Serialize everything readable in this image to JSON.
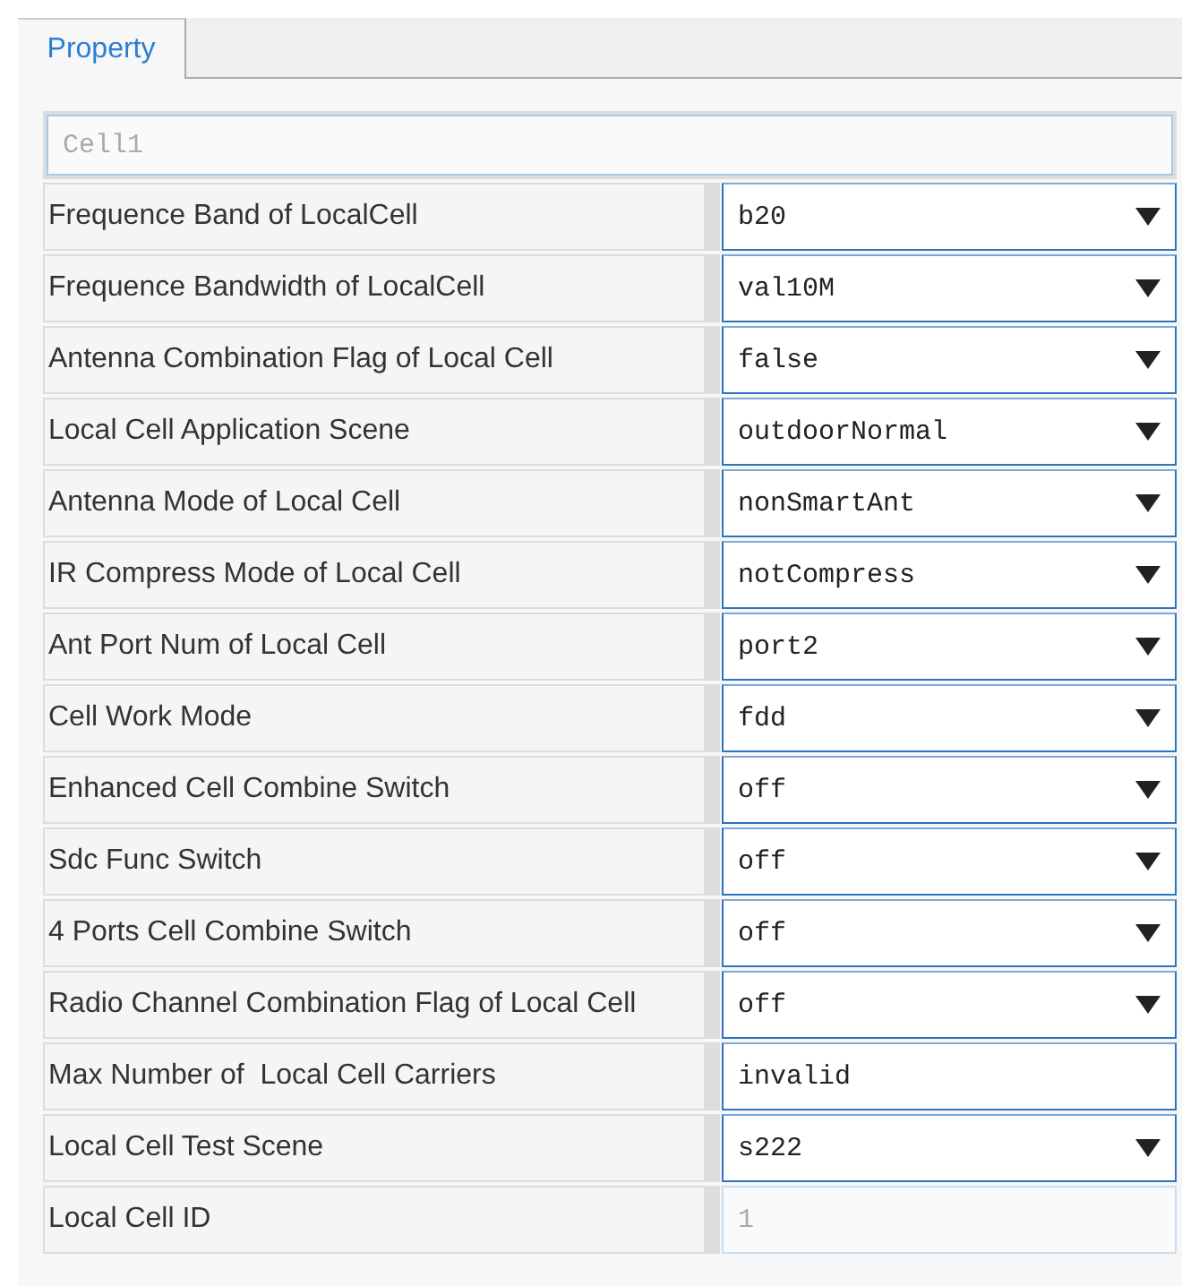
{
  "tabs": [
    {
      "label": "Property",
      "selected": true
    }
  ],
  "name_field": {
    "value": "Cell1",
    "disabled": true
  },
  "rows": [
    {
      "label": "Frequence Band of LocalCell",
      "kind": "select",
      "value": "b20"
    },
    {
      "label": "Frequence Bandwidth of LocalCell",
      "kind": "select",
      "value": "val10M"
    },
    {
      "label": "Antenna Combination Flag of Local Cell",
      "kind": "select",
      "value": "false"
    },
    {
      "label": "Local Cell Application Scene",
      "kind": "select",
      "value": "outdoorNormal"
    },
    {
      "label": "Antenna Mode of Local Cell",
      "kind": "select",
      "value": "nonSmartAnt"
    },
    {
      "label": "IR Compress Mode of Local Cell",
      "kind": "select",
      "value": "notCompress"
    },
    {
      "label": "Ant Port Num of Local Cell",
      "kind": "select",
      "value": "port2"
    },
    {
      "label": "Cell Work Mode",
      "kind": "select",
      "value": "fdd"
    },
    {
      "label": "Enhanced Cell Combine Switch",
      "kind": "select",
      "value": "off"
    },
    {
      "label": "Sdc Func Switch",
      "kind": "select",
      "value": "off"
    },
    {
      "label": "4 Ports Cell Combine Switch",
      "kind": "select",
      "value": "off"
    },
    {
      "label": "Radio Channel Combination Flag of Local Cell",
      "kind": "select",
      "value": "off"
    },
    {
      "label": "Max Number of  Local Cell Carriers",
      "kind": "text",
      "value": "invalid"
    },
    {
      "label": "Local Cell Test Scene",
      "kind": "select",
      "value": "s222"
    },
    {
      "label": "Local Cell ID",
      "kind": "readonly",
      "value": "1"
    }
  ]
}
